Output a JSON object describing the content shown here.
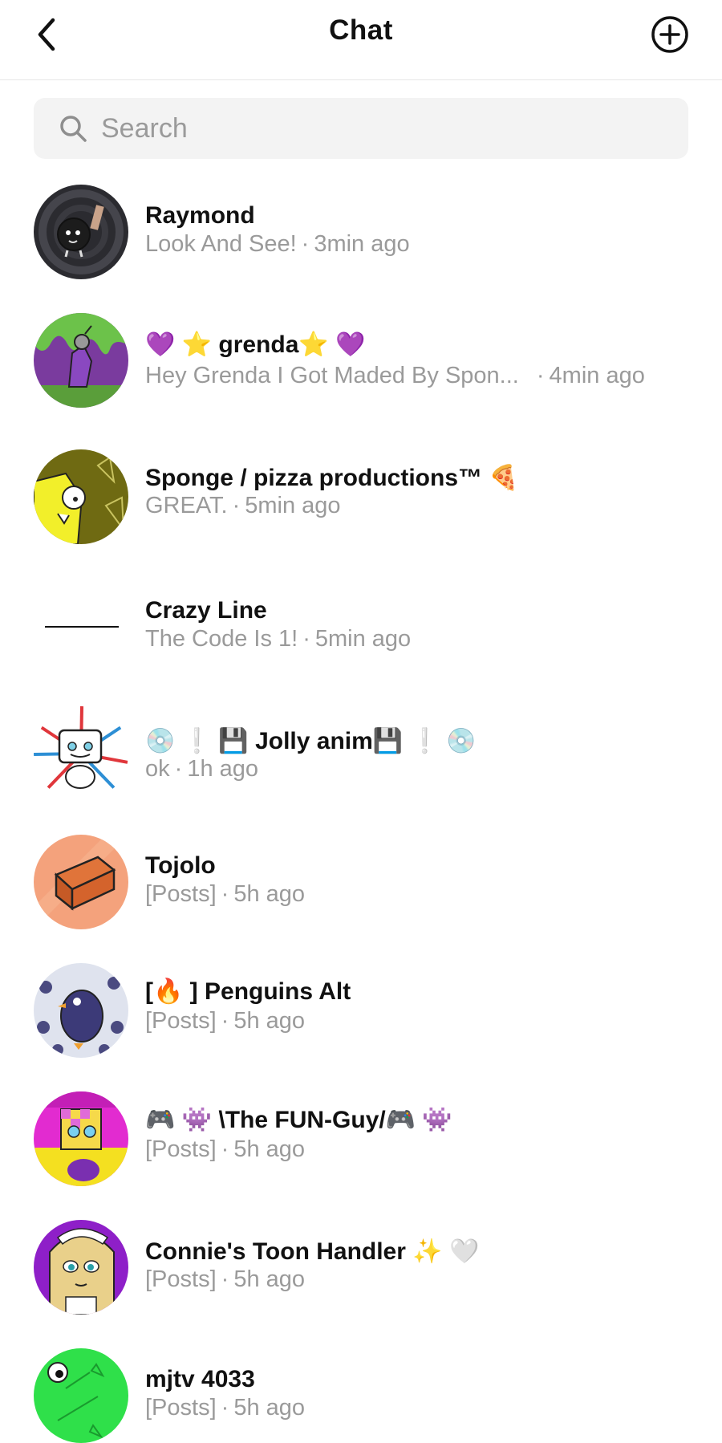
{
  "header": {
    "title": "Chat"
  },
  "search": {
    "placeholder": "Search"
  },
  "chats": [
    {
      "name": "Raymond",
      "message": "Look And See!",
      "time": "3min ago"
    },
    {
      "name": "💜 ⭐ grenda⭐ 💜",
      "message": "Hey Grenda I Got Maded By Spon...",
      "time": "4min ago"
    },
    {
      "name": "Sponge / pizza productions™ 🍕",
      "message": "GREAT.",
      "time": "5min ago"
    },
    {
      "name": "Crazy Line",
      "message": "The Code Is 1!",
      "time": "5min ago"
    },
    {
      "name": "💿 ❕ 💾 Jolly anim💾 ❕ 💿",
      "message": "ok",
      "time": "1h ago"
    },
    {
      "name": "Tojolo",
      "message": "[Posts]",
      "time": "5h ago"
    },
    {
      "name": "[🔥 ] Penguins Alt",
      "message": "[Posts]",
      "time": "5h ago"
    },
    {
      "name": "🎮 👾 \\The FUN-Guy/🎮 👾",
      "message": "[Posts]",
      "time": "5h ago"
    },
    {
      "name": "Connie's Toon Handler ✨ 🤍",
      "message": "[Posts]",
      "time": "5h ago"
    },
    {
      "name": "mjtv 4033",
      "message": "[Posts]",
      "time": "5h ago"
    }
  ]
}
